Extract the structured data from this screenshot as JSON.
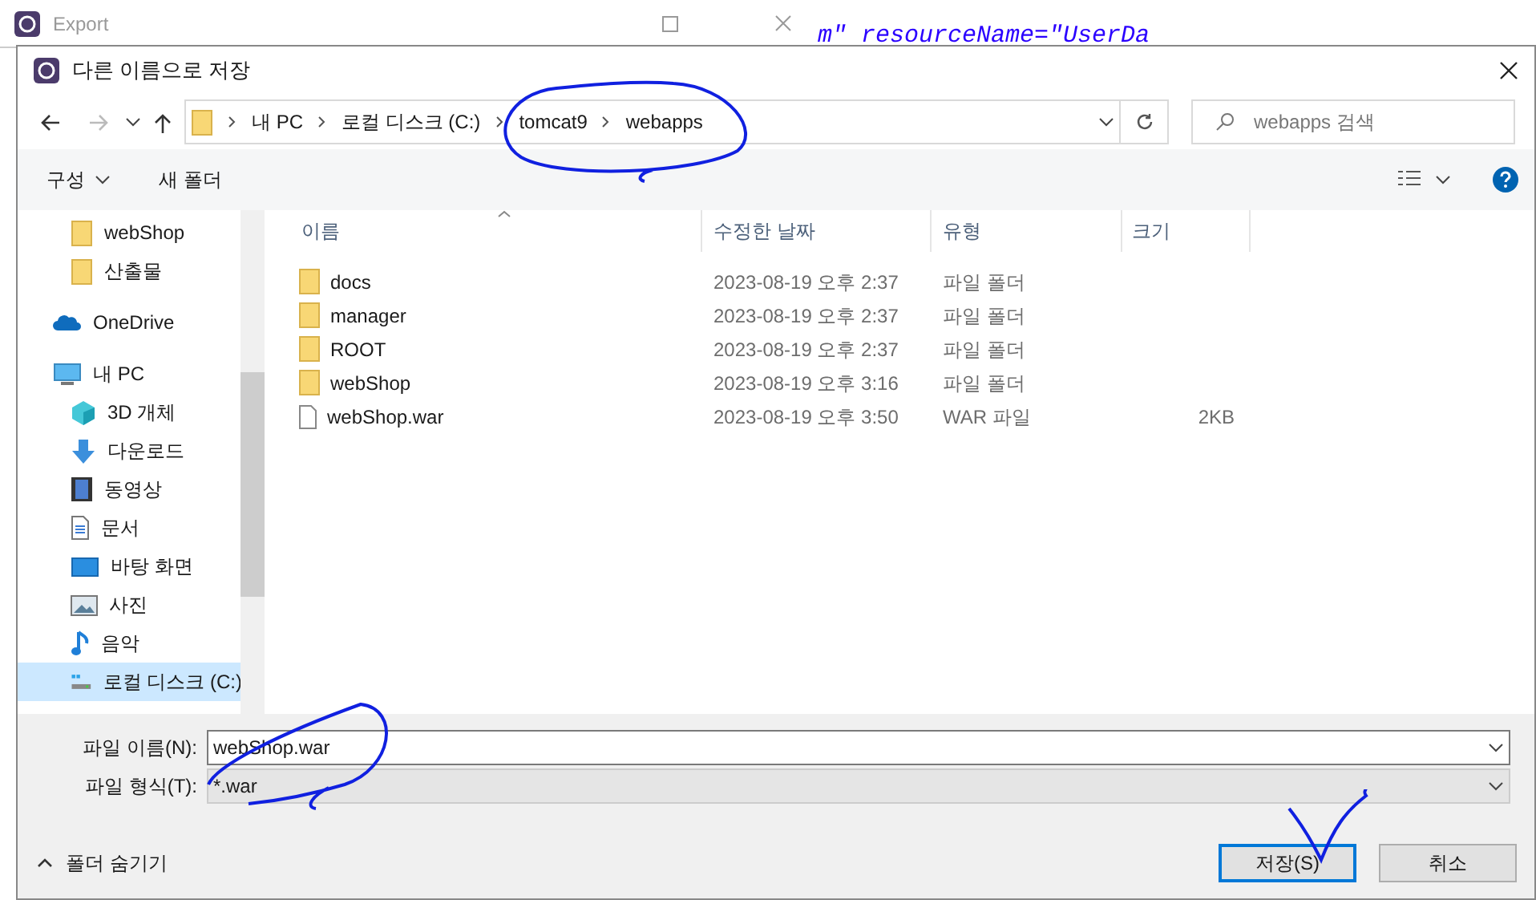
{
  "background_window": {
    "title": "Export"
  },
  "background_code": "m\" resourceName=\"UserDa",
  "dialog": {
    "title": "다른 이름으로 저장"
  },
  "address_bar": {
    "path": [
      "내 PC",
      "로컬 디스크 (C:)",
      "tomcat9",
      "webapps"
    ]
  },
  "search": {
    "placeholder": "webapps 검색"
  },
  "toolbar": {
    "organize": "구성",
    "new_folder": "새 폴더"
  },
  "sidebar": {
    "items": [
      {
        "label": "webShop",
        "kind": "folder",
        "selected": false
      },
      {
        "label": "산출물",
        "kind": "folder",
        "selected": false
      },
      {
        "label": "OneDrive",
        "kind": "cloud",
        "selected": false
      },
      {
        "label": "내 PC",
        "kind": "pc",
        "selected": false,
        "children": [
          {
            "label": "3D 개체",
            "kind": "cube",
            "selected": false
          },
          {
            "label": "다운로드",
            "kind": "download",
            "selected": false
          },
          {
            "label": "동영상",
            "kind": "film",
            "selected": false
          },
          {
            "label": "문서",
            "kind": "document",
            "selected": false
          },
          {
            "label": "바탕 화면",
            "kind": "desktop",
            "selected": false
          },
          {
            "label": "사진",
            "kind": "picture",
            "selected": false
          },
          {
            "label": "음악",
            "kind": "music",
            "selected": false
          },
          {
            "label": "로컬 디스크 (C:)",
            "kind": "drive",
            "selected": true
          }
        ]
      }
    ]
  },
  "table": {
    "columns": [
      "이름",
      "수정한 날짜",
      "유형",
      "크기"
    ],
    "rows": [
      {
        "kind": "folder",
        "name": "docs",
        "date": "2023-08-19 오후 2:37",
        "type": "파일 폴더"
      },
      {
        "kind": "folder",
        "name": "manager",
        "date": "2023-08-19 오후 2:37",
        "type": "파일 폴더"
      },
      {
        "kind": "folder",
        "name": "ROOT",
        "date": "2023-08-19 오후 2:37",
        "type": "파일 폴더"
      },
      {
        "kind": "folder",
        "name": "webShop",
        "date": "2023-08-19 오후 3:16",
        "type": "파일 폴더"
      },
      {
        "kind": "file",
        "name": "webShop.war",
        "date": "2023-08-19 오후 3:50",
        "type": "WAR 파일",
        "size": "2KB"
      }
    ]
  },
  "file_name": {
    "label": "파일 이름(N):",
    "value": "webShop.war"
  },
  "file_type": {
    "label": "파일 형식(T):",
    "value": "*.war"
  },
  "hide_folders": "폴더 숨기기",
  "buttons": [
    {
      "label": "저장(S)",
      "primary": true
    },
    {
      "label": "취소",
      "primary": false
    }
  ]
}
